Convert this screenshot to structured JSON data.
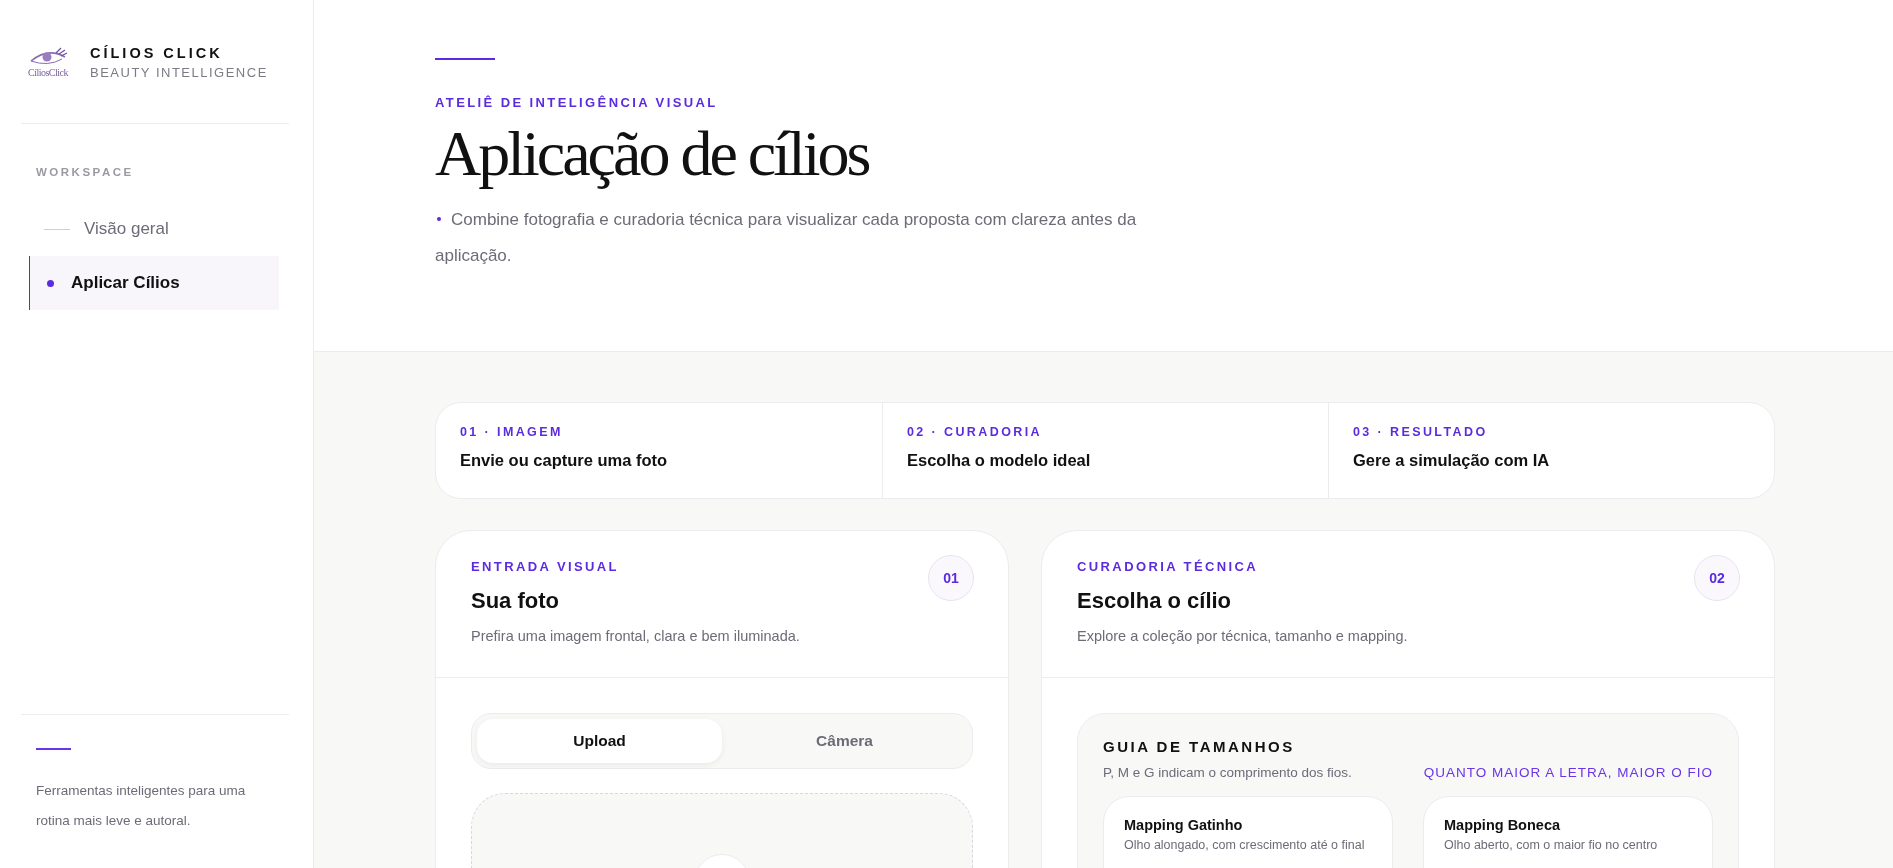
{
  "sidebar": {
    "brand": {
      "logo_text": "CíliosClick",
      "name": "CÍLIOS CLICK",
      "tagline": "BEAUTY INTELLIGENCE"
    },
    "section_label": "WORKSPACE",
    "items": [
      {
        "label": "Visão geral",
        "selected": false
      },
      {
        "label": "Aplicar Cílios",
        "selected": true
      }
    ],
    "footer_text": "Ferramentas inteligentes para uma rotina mais leve e autoral."
  },
  "header": {
    "eyebrow": "ATELIÊ DE INTELIGÊNCIA VISUAL",
    "title": "Aplicação de cílios",
    "description": "Combine fotografia e curadoria técnica para visualizar cada proposta com clareza antes da aplicação."
  },
  "steps": [
    {
      "label": "01 · IMAGEM",
      "title": "Envie ou capture uma foto"
    },
    {
      "label": "02 · CURADORIA",
      "title": "Escolha o modelo ideal"
    },
    {
      "label": "03 · RESULTADO",
      "title": "Gere a simulação com IA"
    }
  ],
  "photo_card": {
    "eyebrow": "ENTRADA VISUAL",
    "title": "Sua foto",
    "subtitle": "Prefira uma imagem frontal, clara e bem iluminada.",
    "badge": "01",
    "modes": [
      {
        "label": "Upload",
        "selected": true
      },
      {
        "label": "Câmera",
        "selected": false
      }
    ]
  },
  "curation_card": {
    "eyebrow": "CURADORIA TÉCNICA",
    "title": "Escolha o cílio",
    "subtitle": "Explore a coleção por técnica, tamanho e mapping.",
    "badge": "02",
    "size_guide": {
      "title": "GUIA DE TAMANHOS",
      "note": "P, M e G indicam o comprimento dos fios.",
      "hint": "QUANTO MAIOR A LETRA, MAIOR O FIO",
      "mappings": [
        {
          "title": "Mapping Gatinho",
          "description": "Olho alongado, com crescimento até o final"
        },
        {
          "title": "Mapping Boneca",
          "description": "Olho aberto, com o maior fio no centro"
        }
      ]
    }
  }
}
